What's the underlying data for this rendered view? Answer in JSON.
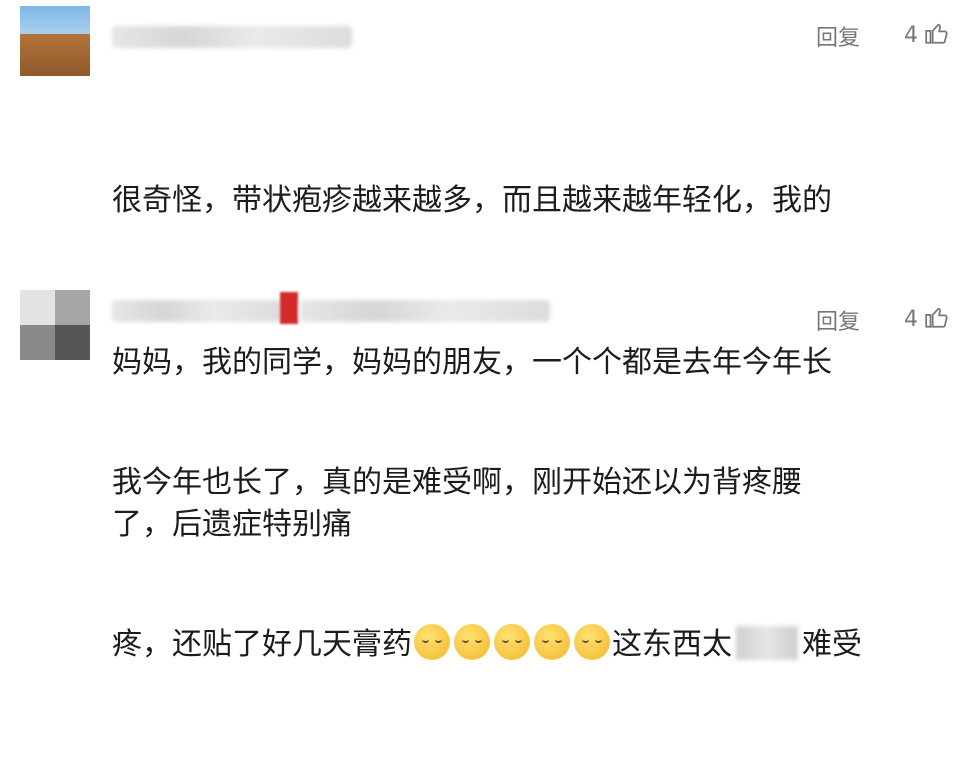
{
  "comments": [
    {
      "reply_label": "回复",
      "likes": "4",
      "lines": [
        "很奇怪，带状疱疹越来越多，而且越来越年轻化，我的",
        "妈妈，我的同学，妈妈的朋友，一个个都是去年今年长",
        "了，后遗症特别痛"
      ]
    },
    {
      "reply_label": "回复",
      "likes": "4",
      "lines": [
        "我今年也长了，真的是难受啊，刚开始还以为背疼腰",
        "疼，还贴了好几天膏药",
        "这东西太",
        "难受"
      ]
    }
  ],
  "icons": {
    "like": "thumbs-up-icon",
    "emoji": "crying-emoji-icon"
  }
}
